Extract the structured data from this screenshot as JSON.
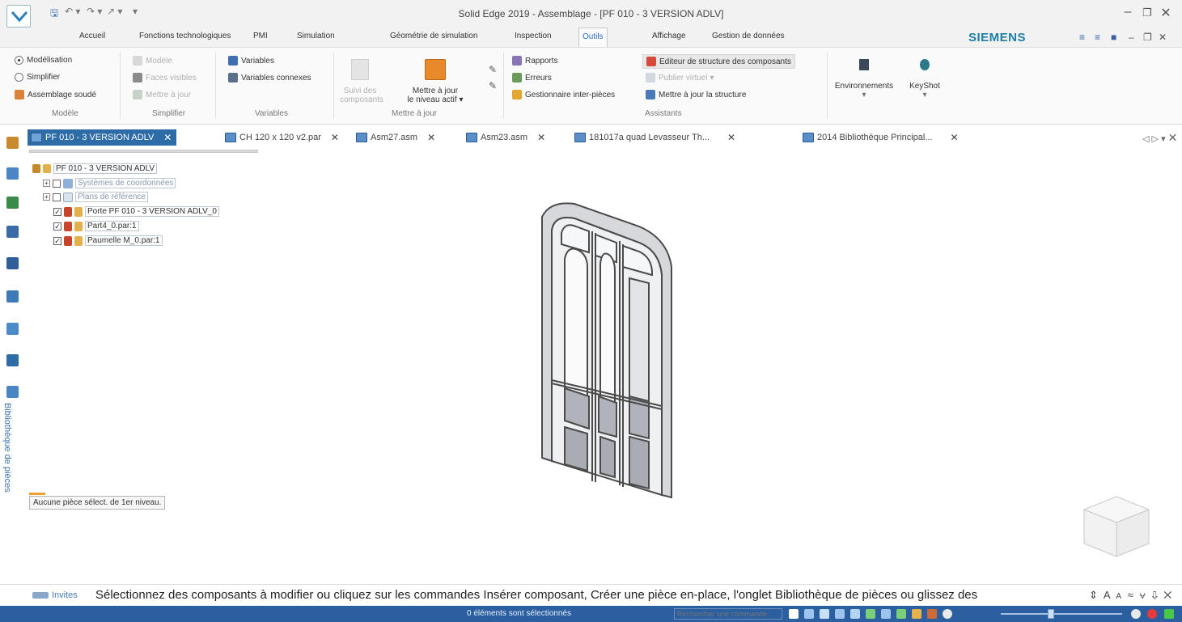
{
  "window": {
    "title": "Solid Edge 2019 - Assemblage - [PF 010 - 3 VERSION ADLV]",
    "brand": "SIEMENS"
  },
  "ribbon_tabs": [
    {
      "label": "Accueil"
    },
    {
      "label": "Fonctions technologiques"
    },
    {
      "label": "PMI"
    },
    {
      "label": "Simulation"
    },
    {
      "label": "Géométrie de simulation"
    },
    {
      "label": "Inspection"
    },
    {
      "label": "Outils"
    },
    {
      "label": "Affichage"
    },
    {
      "label": "Gestion de données"
    }
  ],
  "ribbon": {
    "modele": {
      "group_label": "Modèle",
      "modelisation": "Modélisation",
      "simplifier": "Simplifier",
      "assemblage_soude": "Assemblage soudé"
    },
    "simplifier": {
      "group_label": "Simplifier",
      "modele": "Modèle",
      "faces_visibles": "Faces visibles",
      "mettre_a_jour": "Mettre à jour"
    },
    "variables": {
      "group_label": "Variables",
      "variables": "Variables",
      "variables_connexes": "Variables connexes"
    },
    "mettre_a_jour": {
      "group_label": "Mettre à jour",
      "suivi_line1": "Suivi des",
      "suivi_line2": "composants",
      "niveau_line1": "Mettre à jour",
      "niveau_line2": "le niveau actif ▾"
    },
    "assistants": {
      "group_label": "Assistants",
      "rapports": "Rapports",
      "erreurs": "Erreurs",
      "gestionnaire": "Gestionnaire inter-pièces",
      "editeur": "Editeur de structure des composants",
      "publier": "Publier virtuel ▾",
      "maj_structure": "Mettre à jour la structure"
    },
    "environnements": "Environnements",
    "keyshot": "KeyShot"
  },
  "doc_tabs": [
    {
      "label": "PF 010 - 3 VERSION ADLV"
    },
    {
      "label": "CH 120 x 120 v2.par"
    },
    {
      "label": "Asm27.asm"
    },
    {
      "label": "Asm23.asm"
    },
    {
      "label": "181017a quad Levasseur Th..."
    },
    {
      "label": "2014 Bibliothèque Principal..."
    }
  ],
  "tree": {
    "root": "PF 010 - 3 VERSION ADLV",
    "items": [
      {
        "label": "Systèmes de coordonnées"
      },
      {
        "label": "Plans de référence"
      },
      {
        "label": "Porte PF 010 - 3 VERSION ADLV_0"
      },
      {
        "label": "Part4_0.par:1"
      },
      {
        "label": "Paumelle M_0.par:1"
      }
    ],
    "selection_message": "Aucune pièce sélect. de 1er niveau."
  },
  "left_toolbar": {
    "library_label": "Bibliothèque de pièces"
  },
  "prompt": {
    "label": "Invites",
    "text": "Sélectionnez des composants à modifier ou cliquez sur les commandes Insérer composant, Créer une pièce en-place, l'onglet Bibliothèque de pièces ou glissez des"
  },
  "status": {
    "selection_text": "0 éléments sont sélectionnés",
    "search_placeholder": "Rechercher une commande"
  },
  "colors": {
    "accent": "#2e6ca8",
    "statusbar": "#2b5fa0",
    "brand": "#1c7fa6"
  }
}
